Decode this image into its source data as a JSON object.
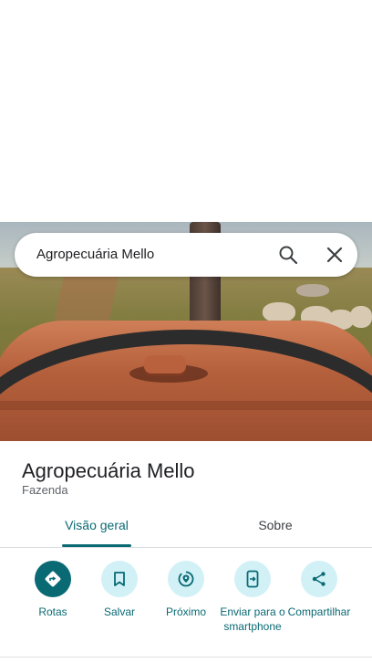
{
  "search": {
    "query": "Agropecuária Mello"
  },
  "place": {
    "name": "Agropecuária Mello",
    "category": "Fazenda"
  },
  "tabs": [
    {
      "label": "Visão geral",
      "active": true
    },
    {
      "label": "Sobre",
      "active": false
    }
  ],
  "actions": [
    {
      "label": "Rotas",
      "icon": "directions-icon"
    },
    {
      "label": "Salvar",
      "icon": "bookmark-icon"
    },
    {
      "label": "Próximo",
      "icon": "nearby-icon"
    },
    {
      "label": "Enviar para o smartphone",
      "icon": "send-to-phone-icon"
    },
    {
      "label": "Compartilhar",
      "icon": "share-icon"
    }
  ],
  "colors": {
    "accent": "#0a6a74",
    "chip": "#d2f1f6"
  }
}
